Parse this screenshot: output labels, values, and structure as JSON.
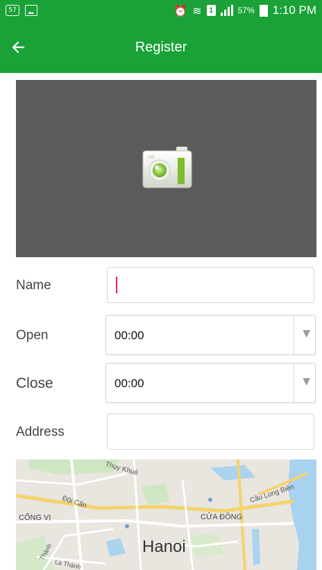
{
  "status_bar": {
    "notification_badge": "57",
    "battery_percent": "57%",
    "time": "1:10 PM",
    "sim_slot": "1",
    "icons": [
      "notification-count-icon",
      "image-notification-icon",
      "alarm-icon",
      "wifi-icon",
      "sim-icon",
      "signal-icon",
      "battery-charging-icon"
    ]
  },
  "app_bar": {
    "title": "Register",
    "back_icon": "arrow-left-icon"
  },
  "photo": {
    "icon": "camera-icon",
    "background": "#5c5b5c"
  },
  "form": {
    "name_label": "Name",
    "name_value": "",
    "open_label": "Open",
    "open_value": "00:00",
    "close_label": "Close",
    "close_value": "00:00",
    "address_label": "Address",
    "address_value": "",
    "dropdown_icon": "triangle-down-icon"
  },
  "map": {
    "city_label": "Hanoi",
    "labels": {
      "cong_vi": "CỐNG VỊ",
      "cua_dong": "CỬA ĐÔNG",
      "doi_can": "Đội Cấn",
      "thuy_khue": "Thụy Khuê",
      "cau_long_bien": "Cầu Long Biên",
      "la_thanh": "La Thành",
      "thanh": "Thành"
    }
  },
  "colors": {
    "primary": "#1aa238",
    "accent": "#e91e63"
  }
}
